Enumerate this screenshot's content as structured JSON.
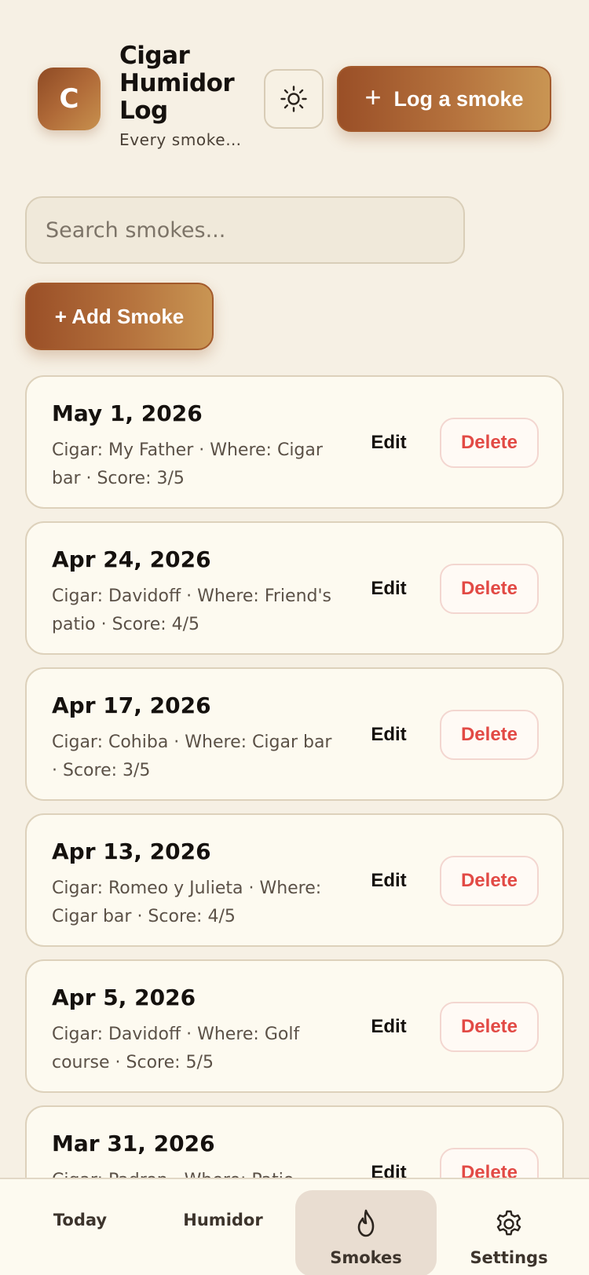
{
  "header": {
    "logo_letter": "C",
    "title": "Cigar Humidor Log",
    "subtitle": "Every smoke…",
    "theme_icon": "sun-icon",
    "log_button_label": "Log a smoke"
  },
  "search": {
    "placeholder": "Search smokes..."
  },
  "add_button_label": "+ Add Smoke",
  "actions": {
    "edit_label": "Edit",
    "delete_label": "Delete"
  },
  "smokes": [
    {
      "date": "May 1, 2026",
      "meta": "Cigar: My Father · Where: Cigar bar · Score: 3/5"
    },
    {
      "date": "Apr 24, 2026",
      "meta": "Cigar: Davidoff · Where: Friend's patio · Score: 4/5"
    },
    {
      "date": "Apr 17, 2026",
      "meta": "Cigar: Cohiba · Where: Cigar bar · Score: 3/5"
    },
    {
      "date": "Apr 13, 2026",
      "meta": "Cigar: Romeo y Julieta · Where: Cigar bar · Score: 4/5"
    },
    {
      "date": "Apr 5, 2026",
      "meta": "Cigar: Davidoff · Where: Golf course · Score: 5/5"
    },
    {
      "date": "Mar 31, 2026",
      "meta": "Cigar: Padron · Where: Patio ·"
    }
  ],
  "nav": {
    "items": [
      {
        "label": "Today"
      },
      {
        "label": "Humidor"
      },
      {
        "label": "Smokes",
        "icon": "flame-icon",
        "active": true
      },
      {
        "label": "Settings",
        "icon": "gear-icon"
      }
    ]
  },
  "colors": {
    "background": "#f6f0e4",
    "accent_start": "#9a4f27",
    "accent_end": "#c99553",
    "delete_red": "#e24a45",
    "active_nav_bg": "#e9ddd1"
  }
}
